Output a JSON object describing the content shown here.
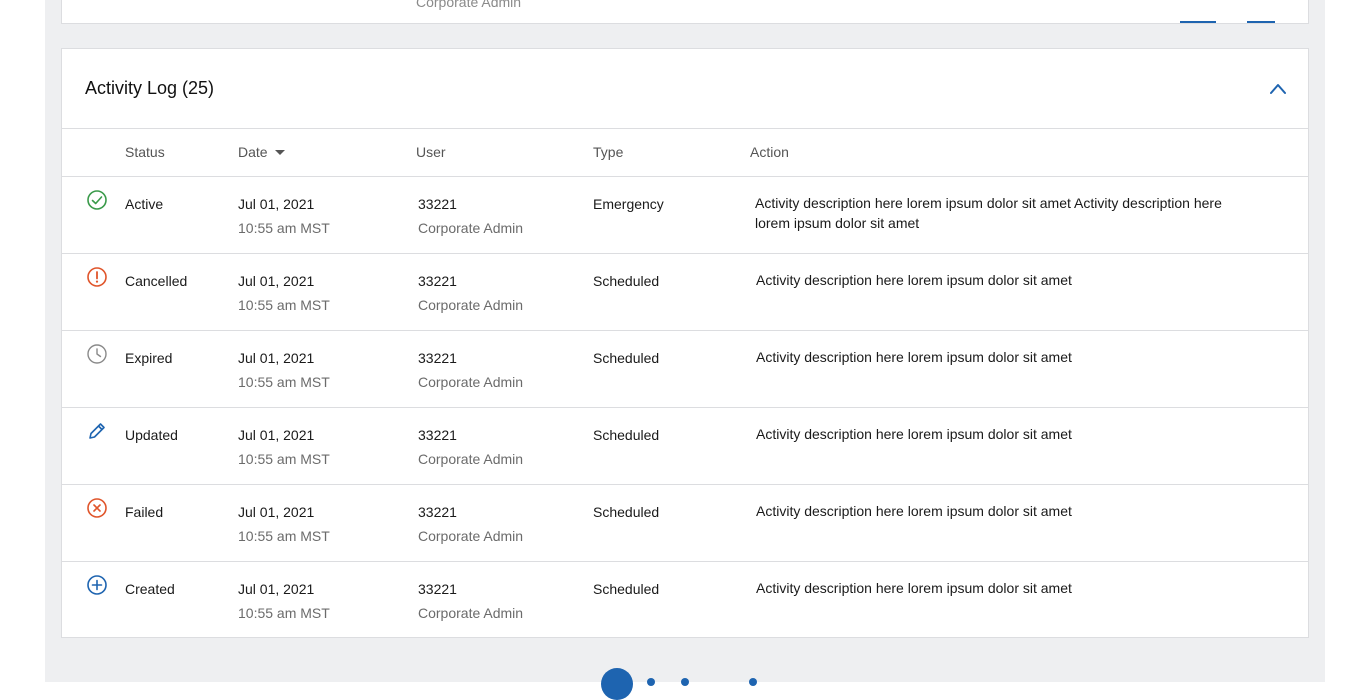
{
  "previous_card": {
    "user_role": "Corporate Admin"
  },
  "activity_log": {
    "title": "Activity Log (25)",
    "columns": {
      "status": "Status",
      "date": "Date",
      "user": "User",
      "type": "Type",
      "action": "Action"
    },
    "rows": [
      {
        "status": "Active",
        "icon": "check-circle-icon",
        "date": "Jul 01, 2021",
        "time": "10:55 am MST",
        "user_id": "33221",
        "user_role": "Corporate Admin",
        "type": "Emergency",
        "action": "Activity description here lorem ipsum dolor sit amet Activity description here lorem ipsum dolor sit amet"
      },
      {
        "status": "Cancelled",
        "icon": "alert-circle-icon",
        "date": "Jul 01, 2021",
        "time": "10:55 am MST",
        "user_id": "33221",
        "user_role": "Corporate Admin",
        "type": "Scheduled",
        "action": "Activity description here lorem ipsum dolor sit amet"
      },
      {
        "status": "Expired",
        "icon": "clock-icon",
        "date": "Jul 01, 2021",
        "time": "10:55 am MST",
        "user_id": "33221",
        "user_role": "Corporate Admin",
        "type": "Scheduled",
        "action": "Activity description here lorem ipsum dolor sit amet"
      },
      {
        "status": "Updated",
        "icon": "pencil-icon",
        "date": "Jul 01, 2021",
        "time": "10:55 am MST",
        "user_id": "33221",
        "user_role": "Corporate Admin",
        "type": "Scheduled",
        "action": "Activity description here lorem ipsum dolor sit amet"
      },
      {
        "status": "Failed",
        "icon": "x-circle-icon",
        "date": "Jul 01, 2021",
        "time": "10:55 am MST",
        "user_id": "33221",
        "user_role": "Corporate Admin",
        "type": "Scheduled",
        "action": "Activity description here lorem ipsum dolor sit amet"
      },
      {
        "status": "Created",
        "icon": "plus-circle-icon",
        "date": "Jul 01, 2021",
        "time": "10:55 am MST",
        "user_id": "33221",
        "user_role": "Corporate Admin",
        "type": "Scheduled",
        "action": "Activity description here lorem ipsum dolor sit amet"
      }
    ]
  },
  "colors": {
    "accent": "#1e64b0",
    "success": "#3a9a4a",
    "warning": "#e0552b",
    "muted_icon": "#8a8a8a",
    "page_bg": "#eeeff1",
    "border": "#dcdde0"
  }
}
